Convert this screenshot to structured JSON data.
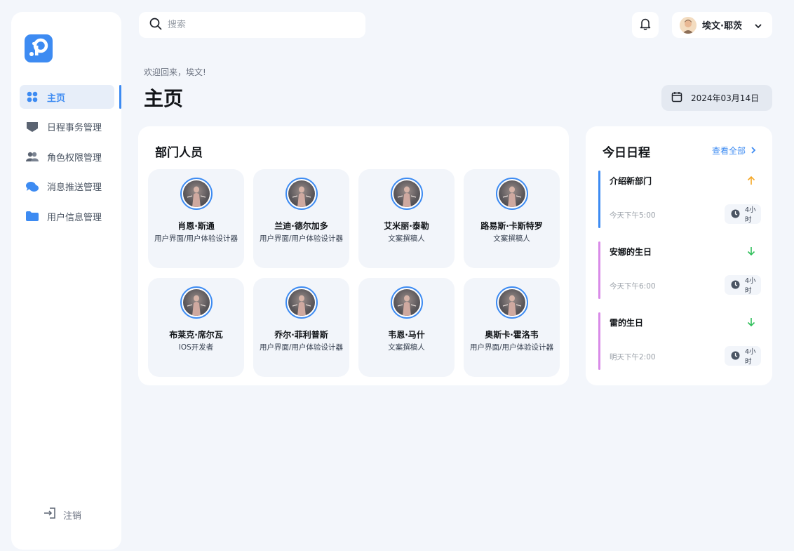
{
  "sidebar": {
    "items": [
      {
        "label": "主页",
        "icon": "grid-icon",
        "active": true
      },
      {
        "label": "日程事务管理",
        "icon": "inbox-icon",
        "active": false
      },
      {
        "label": "角色权限管理",
        "icon": "users-icon",
        "active": false
      },
      {
        "label": "消息推送管理",
        "icon": "chat-icon",
        "active": false
      },
      {
        "label": "用户信息管理",
        "icon": "folder-icon",
        "active": false
      }
    ],
    "logout_label": "注销"
  },
  "search": {
    "placeholder": "搜索"
  },
  "user": {
    "name": "埃文·耶茨"
  },
  "header": {
    "welcome": "欢迎回来，埃文!",
    "title": "主页",
    "date": "2024年03月14日"
  },
  "department": {
    "title": "部门人员",
    "members": [
      {
        "name": "肖恩·斯通",
        "role": "用户界面/用户体验设计器"
      },
      {
        "name": "兰迪·德尔加多",
        "role": "用户界面/用户体验设计器"
      },
      {
        "name": "艾米丽·泰勒",
        "role": "文案撰稿人"
      },
      {
        "name": "路易斯·卡斯特罗",
        "role": "文案撰稿人"
      },
      {
        "name": "布莱克·席尔瓦",
        "role": "IOS开发者"
      },
      {
        "name": "乔尔·菲利普斯",
        "role": "用户界面/用户体验设计器"
      },
      {
        "name": "韦恩·马什",
        "role": "文案撰稿人"
      },
      {
        "name": "奥斯卡·霍洛韦",
        "role": "用户界面/用户体验设计器"
      }
    ]
  },
  "schedule": {
    "title": "今日日程",
    "view_all": "查看全部",
    "events": [
      {
        "title": "介绍新部门",
        "time": "今天下午5:00",
        "duration": "4小时",
        "priority": "up",
        "color": "#3d8bf2",
        "priority_color": "#f5a623"
      },
      {
        "title": "安娜的生日",
        "time": "今天下午6:00",
        "duration": "4小时",
        "priority": "down",
        "color": "#d98be8",
        "priority_color": "#2fbf5a"
      },
      {
        "title": "雷的生日",
        "time": "明天下午2:00",
        "duration": "4小时",
        "priority": "down",
        "color": "#d98be8",
        "priority_color": "#2fbf5a"
      }
    ]
  },
  "colors": {
    "accent": "#3d8bf2",
    "background": "#f3f6fb"
  }
}
